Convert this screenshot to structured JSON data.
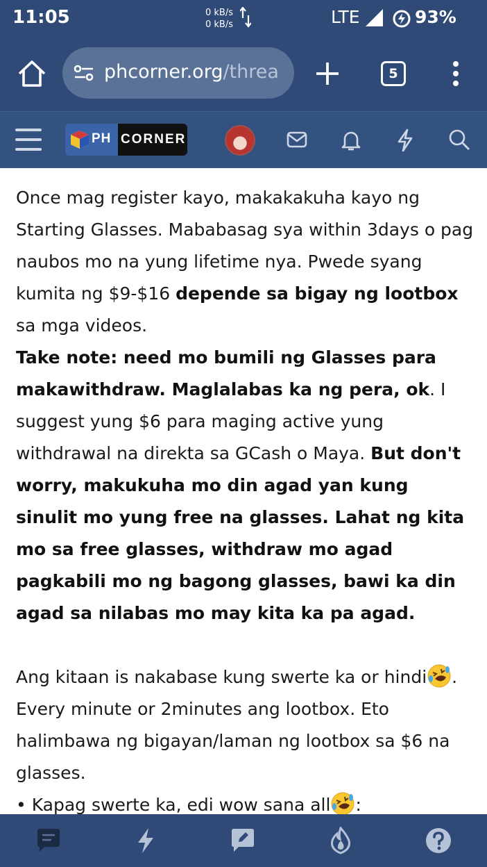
{
  "status_bar": {
    "time": "11:05",
    "net_up": "0 kB/s",
    "net_down": "0 kB/s",
    "network": "LTE",
    "battery": "93%"
  },
  "browser": {
    "url_host": "phcorner.org",
    "url_path": "/threa",
    "tab_count": "5"
  },
  "site": {
    "logo_left": "PH",
    "logo_right": "CORNER"
  },
  "post": {
    "p1": "Once mag register kayo, makakakuha kayo ng Starting Glasses. Mababasag sya within 3days o pag naubos mo na yung lifetime nya. Pwede syang kumita ng $9-$16 ",
    "p1_bold": "depende sa bigay ng lootbox",
    "p1_end": " sa mga videos.",
    "p2_bold": "Take note: need mo bumili ng Glasses para makawithdraw. Maglalabas ka ng pera, ok",
    "p2": ". I suggest yung $6 para maging active yung withdrawal na direkta sa GCash o Maya. ",
    "p2_bold2": "But don't worry, makukuha mo din agad yan kung sinulit mo yung free na glasses. Lahat ng kita mo sa free glasses, withdraw mo agad pagkabili mo ng bagong glasses, bawi ka din agad sa nilabas mo may kita ka pa agad.",
    "p3": "Ang kitaan is nakabase kung swerte ka or hindi",
    "p3_end": ". Every minute or 2minutes ang lootbox. Eto halimbawa ng bigayan/laman ng lootbox sa $6 na glasses.",
    "bullet": "• Kapag swerte ka, edi wow sana all",
    "bullet_end": ":"
  },
  "icons": {
    "emoji": "rolling-on-floor-laughing-emoji"
  },
  "colors": {
    "chrome": "#2f4a77",
    "nav": "#34527f",
    "url_box": "#5a7198"
  }
}
